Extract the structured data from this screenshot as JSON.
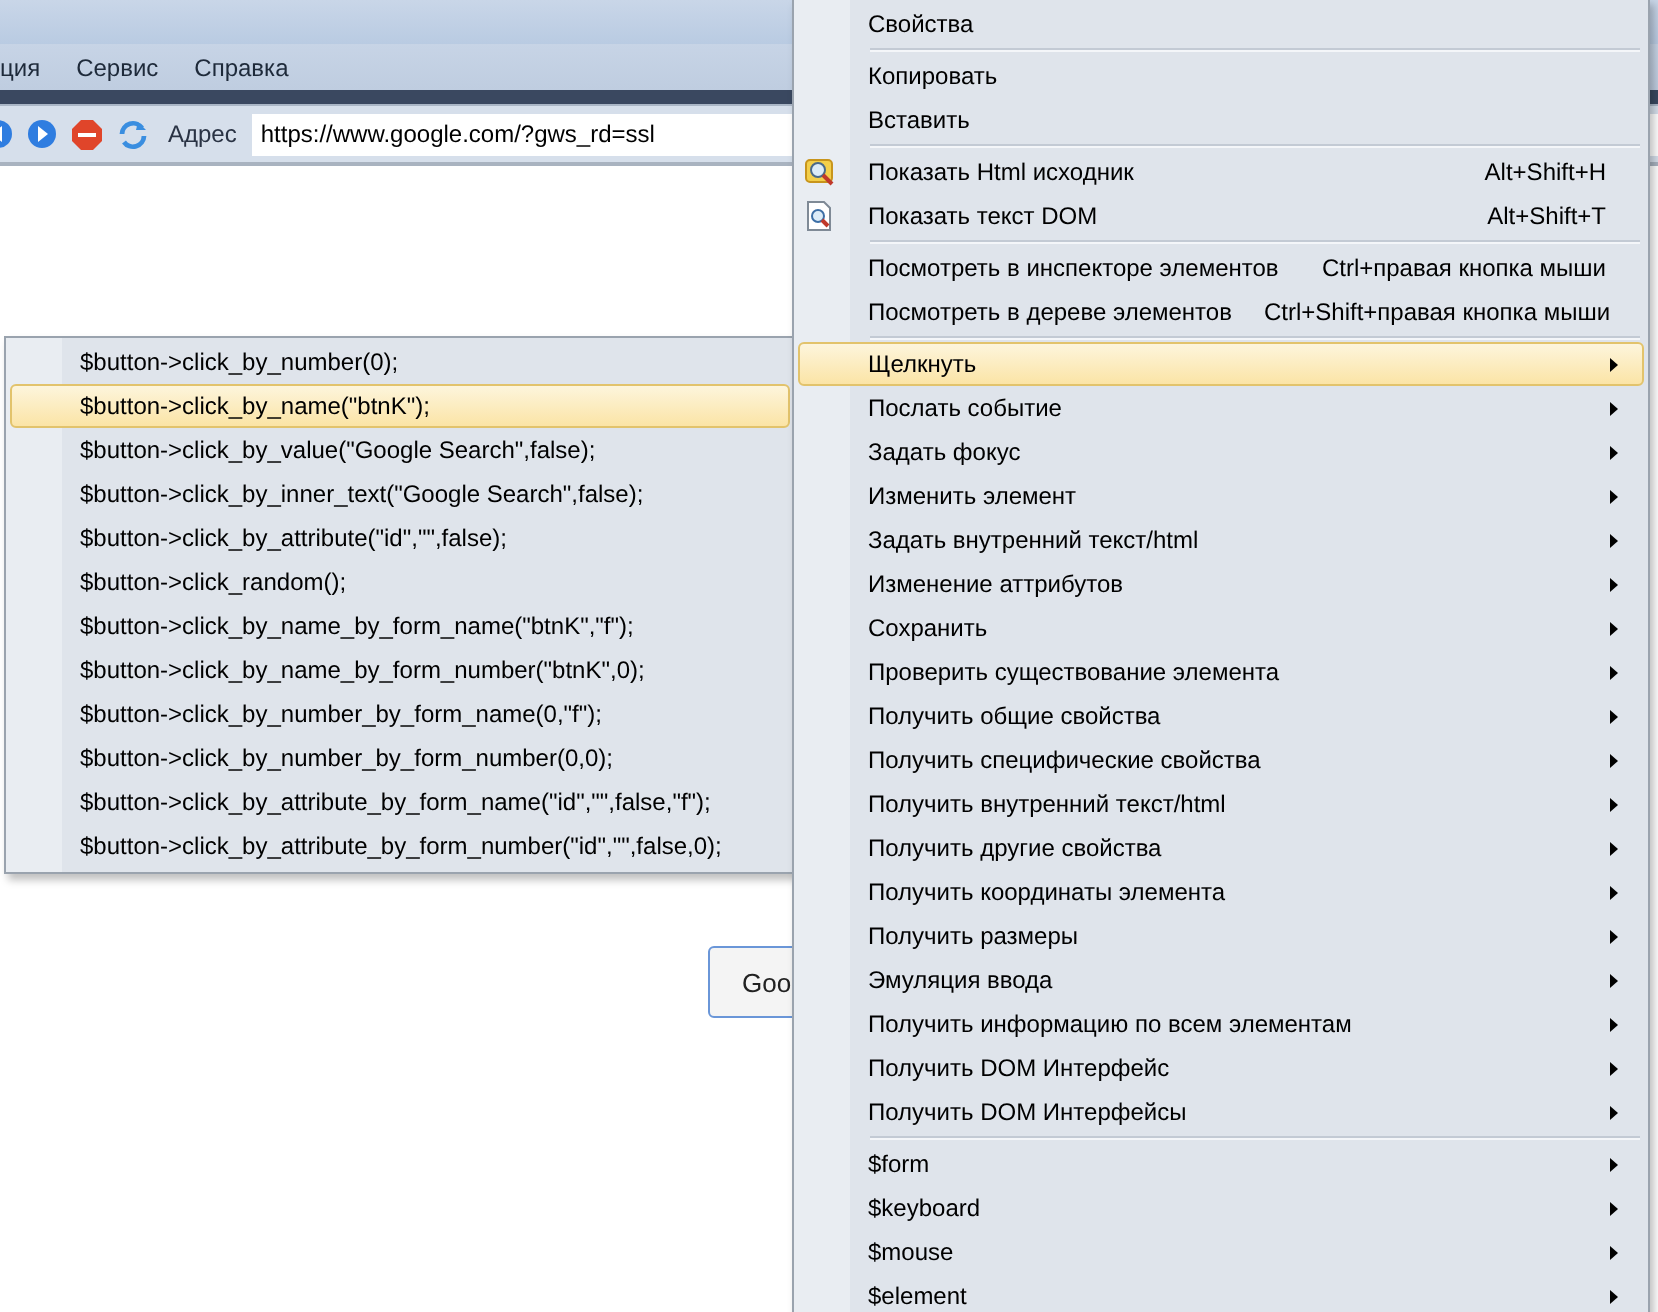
{
  "browser": {
    "menu": [
      "ция",
      "Сервис",
      "Справка"
    ],
    "address_label": "Адрес",
    "address": "https://www.google.com/?gws_rd=ssl",
    "page_button": "Goo"
  },
  "context_menu": {
    "groups": [
      [
        {
          "label": "Свойства",
          "selected": false
        }
      ],
      [
        {
          "label": "Копировать",
          "selected": false
        },
        {
          "label": "Вставить",
          "selected": false
        }
      ],
      [
        {
          "label": "Показать Html исходник",
          "shortcut": "Alt+Shift+H",
          "kind": "source",
          "selected": false
        },
        {
          "label": "Показать текст DOM",
          "shortcut": "Alt+Shift+T",
          "kind": "document",
          "selected": false
        }
      ],
      [
        {
          "label": "Посмотреть в инспекторе элементов",
          "shortcut": "Ctrl+правая кнопка мыши",
          "selected": false
        },
        {
          "label": "Посмотреть в дереве элементов",
          "shortcut": "Ctrl+Shift+правая кнопка мыши",
          "selected": false
        }
      ],
      [
        {
          "label": "Щелкнуть",
          "submenu": true,
          "selected": true
        },
        {
          "label": "Послать событие",
          "submenu": true,
          "selected": false
        },
        {
          "label": "Задать фокус",
          "submenu": true,
          "selected": false
        },
        {
          "label": "Изменить элемент",
          "submenu": true,
          "selected": false
        },
        {
          "label": "Задать внутренний текст/html",
          "submenu": true,
          "selected": false
        },
        {
          "label": "Изменение аттрибутов",
          "submenu": true,
          "selected": false
        },
        {
          "label": "Сохранить",
          "submenu": true,
          "selected": false
        },
        {
          "label": "Проверить существование элемента",
          "submenu": true,
          "selected": false
        },
        {
          "label": "Получить общие свойства",
          "submenu": true,
          "selected": false
        },
        {
          "label": "Получить специфические свойства",
          "submenu": true,
          "selected": false
        },
        {
          "label": "Получить внутренний текст/html",
          "submenu": true,
          "selected": false
        },
        {
          "label": "Получить другие свойства",
          "submenu": true,
          "selected": false
        },
        {
          "label": "Получить координаты элемента",
          "submenu": true,
          "selected": false
        },
        {
          "label": "Получить размеры",
          "submenu": true,
          "selected": false
        },
        {
          "label": "Эмуляция ввода",
          "submenu": true,
          "selected": false
        },
        {
          "label": "Получить информацию по всем элементам",
          "submenu": true,
          "selected": false
        },
        {
          "label": "Получить DOM Интерфейс",
          "submenu": true,
          "selected": false
        },
        {
          "label": "Получить DOM Интерфейсы",
          "submenu": true,
          "selected": false
        }
      ],
      [
        {
          "label": "$form",
          "submenu": true,
          "selected": false
        },
        {
          "label": "$keyboard",
          "submenu": true,
          "selected": false
        },
        {
          "label": "$mouse",
          "submenu": true,
          "selected": false
        },
        {
          "label": "$element",
          "submenu": true,
          "selected": false
        }
      ]
    ]
  },
  "submenu": {
    "items": [
      {
        "label": "$button->click_by_number(0);",
        "selected": false
      },
      {
        "label": "$button->click_by_name(\"btnK\");",
        "selected": true
      },
      {
        "label": "$button->click_by_value(\"Google Search\",false);",
        "selected": false
      },
      {
        "label": "$button->click_by_inner_text(\"Google Search\",false);",
        "selected": false
      },
      {
        "label": "$button->click_by_attribute(\"id\",\"\",false);",
        "selected": false
      },
      {
        "label": "$button->click_random();",
        "selected": false
      },
      {
        "label": "$button->click_by_name_by_form_name(\"btnK\",\"f\");",
        "selected": false
      },
      {
        "label": "$button->click_by_name_by_form_number(\"btnK\",0);",
        "selected": false
      },
      {
        "label": "$button->click_by_number_by_form_name(0,\"f\");",
        "selected": false
      },
      {
        "label": "$button->click_by_number_by_form_number(0,0);",
        "selected": false
      },
      {
        "label": "$button->click_by_attribute_by_form_name(\"id\",\"\",false,\"f\");",
        "selected": false
      },
      {
        "label": "$button->click_by_attribute_by_form_number(\"id\",\"\",false,0);",
        "selected": false
      }
    ]
  }
}
